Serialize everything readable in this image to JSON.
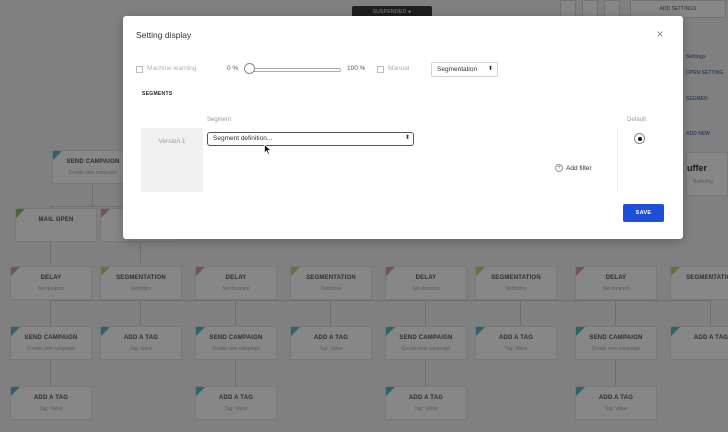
{
  "background": {
    "top_pill": "SUSPENDED ●",
    "top_buttons": [
      "",
      "",
      "",
      "ADD SETTINGS"
    ],
    "side_items": [
      "Settings",
      "OPEN SETTING",
      "SEGMEN",
      "ADD NEW"
    ],
    "side_card": {
      "title": "uffer",
      "subtitle": "Buffering"
    },
    "nodes": [
      {
        "title": "SEND CAMPAIGN",
        "subtitle": "Create new campaign",
        "color": "#59b7d6"
      },
      {
        "title": "MAIL OPEN",
        "subtitle": "",
        "color": "#8dc26f"
      },
      {
        "title": "",
        "subtitle": "",
        "color": "#e29ab2"
      },
      {
        "title": "DELAY",
        "subtitle": "",
        "color": "#e29ab2"
      },
      {
        "title": "DELAY",
        "subtitle": "Set duration",
        "color": "#e29ab2"
      },
      {
        "title": "SEGMENTATION",
        "subtitle": "Definition",
        "color": "#d8cc6a"
      },
      {
        "title": "DELAY",
        "subtitle": "Set duration",
        "color": "#e29ab2"
      },
      {
        "title": "SEGMENTATION",
        "subtitle": "Definition",
        "color": "#d8cc6a"
      },
      {
        "title": "DELAY",
        "subtitle": "Set duration",
        "color": "#e29ab2"
      },
      {
        "title": "SEGMENTATION",
        "subtitle": "Definition",
        "color": "#d8cc6a"
      },
      {
        "title": "DELAY",
        "subtitle": "Set duration",
        "color": "#e29ab2"
      },
      {
        "title": "SEGMENTATION",
        "subtitle": "",
        "color": "#d8cc6a"
      },
      {
        "title": "SEND CAMPAIGN",
        "subtitle": "Create new campaign",
        "color": "#59b7d6"
      },
      {
        "title": "ADD A TAG",
        "subtitle": "Tag: Value",
        "color": "#59b7d6"
      },
      {
        "title": "SEND CAMPAIGN",
        "subtitle": "Create new campaign",
        "color": "#59b7d6"
      },
      {
        "title": "ADD A TAG",
        "subtitle": "Tag: Value",
        "color": "#59b7d6"
      },
      {
        "title": "SEND CAMPAIGN",
        "subtitle": "Create new campaign",
        "color": "#59b7d6"
      },
      {
        "title": "ADD A TAG",
        "subtitle": "Tag: Value",
        "color": "#59b7d6"
      },
      {
        "title": "SEND CAMPAIGN",
        "subtitle": "Create new campaign",
        "color": "#59b7d6"
      },
      {
        "title": "ADD A TAG",
        "subtitle": "",
        "color": "#59b7d6"
      },
      {
        "title": "ADD A TAG",
        "subtitle": "Tag: Value",
        "color": "#59b7d6"
      },
      {
        "title": "ADD A TAG",
        "subtitle": "Tag: Value",
        "color": "#59b7d6"
      },
      {
        "title": "ADD A TAG",
        "subtitle": "Tag: Value",
        "color": "#59b7d6"
      },
      {
        "title": "ADD A TAG",
        "subtitle": "Tag: Value",
        "color": "#59b7d6"
      }
    ]
  },
  "modal": {
    "title": "Setting display",
    "close_icon": "close-icon",
    "controls": {
      "machine_learning_label": "Machine learning",
      "machine_learning_checked": false,
      "slider_min_label": "0 %",
      "slider_max_label": "100 %",
      "slider_value_percent": 0,
      "manual_label": "Manual",
      "manual_checked": false,
      "mode_select": {
        "value": "Segmentation",
        "arrow": "⬍"
      }
    },
    "section_heading": "SEGMENTS",
    "columns": {
      "segment": "Segment",
      "default": "Default"
    },
    "version": {
      "label": "Version 1",
      "segment_select": {
        "value": "Segment definition...",
        "arrow": "⬍"
      },
      "add_filter_label": "Add filter",
      "add_filter_icon": "+",
      "is_default": true
    },
    "save_label": "SAVE",
    "save_color": "#1e4fd8"
  }
}
